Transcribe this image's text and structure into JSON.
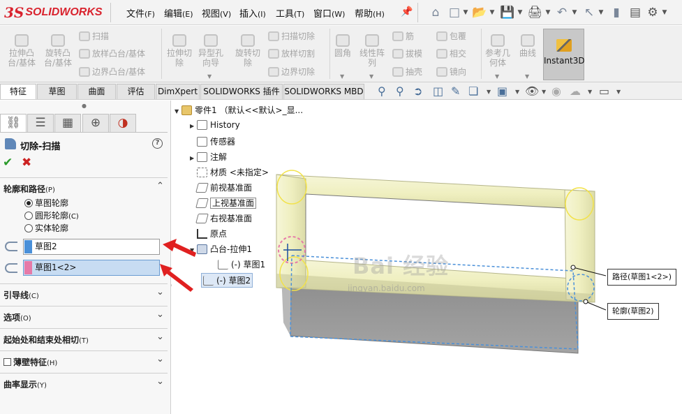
{
  "app": {
    "logo_prefix": "3S",
    "logo_text": "SOLIDWORKS"
  },
  "menu": [
    {
      "label": "文件",
      "accel": "(F)"
    },
    {
      "label": "编辑",
      "accel": "(E)"
    },
    {
      "label": "视图",
      "accel": "(V)"
    },
    {
      "label": "插入",
      "accel": "(I)"
    },
    {
      "label": "工具",
      "accel": "(T)"
    },
    {
      "label": "窗口",
      "accel": "(W)"
    },
    {
      "label": "帮助",
      "accel": "(H)"
    }
  ],
  "ribbon": {
    "extrude_boss": "拉伸凸台/基体",
    "revolve_boss": "旋转凸台/基体",
    "sweep": "扫描",
    "loft_boss": "放样凸台/基体",
    "boundary_boss": "边界凸台/基体",
    "extrude_cut": "拉伸切除",
    "hole_wizard": "异型孔向导",
    "revolve_cut": "旋转切除",
    "sweep_cut": "扫描切除",
    "loft_cut": "放样切割",
    "boundary_cut": "边界切除",
    "fillet": "圆角",
    "linear_pattern": "线性阵列",
    "rib": "筋",
    "draft": "拔模",
    "shell": "抽壳",
    "wrap": "包覆",
    "intersect": "相交",
    "mirror": "镜向",
    "ref_geometry": "参考几何体",
    "curves": "曲线",
    "instant3d": "Instant3D"
  },
  "tabs": [
    "特征",
    "草图",
    "曲面",
    "评估",
    "DimXpert",
    "SOLIDWORKS 插件",
    "SOLIDWORKS MBD"
  ],
  "panel": {
    "title": "切除-扫描",
    "help": "?",
    "profile_path": {
      "label": "轮廓和路径",
      "accel": "(P)"
    },
    "radios": [
      {
        "label": "草图轮廓",
        "accel": "",
        "checked": true
      },
      {
        "label": "圆形轮廓",
        "accel": "(C)",
        "checked": false
      },
      {
        "label": "实体轮廓",
        "accel": "",
        "checked": false
      }
    ],
    "profile_value": "草图2",
    "path_value": "草图1<2>",
    "sections": [
      {
        "label": "引导线",
        "accel": "(C)"
      },
      {
        "label": "选项",
        "accel": "(O)"
      },
      {
        "label": "起始处和结束处相切",
        "accel": "(T)"
      },
      {
        "label": "薄壁特征",
        "accel": "(H)"
      },
      {
        "label": "曲率显示",
        "accel": "(Y)"
      }
    ]
  },
  "tree": {
    "root": "零件1 （默认<<默认>_显...",
    "history": "History",
    "sensors": "传感器",
    "annotations": "注解",
    "material": "材质 <未指定>",
    "front_plane": "前视基准面",
    "top_plane": "上视基准面",
    "right_plane": "右视基准面",
    "origin": "原点",
    "boss_extrude": "凸台-拉伸1",
    "sketch1": "(-) 草图1",
    "sketch2": "(-) 草图2"
  },
  "callouts": {
    "path": "路径(草图1<2>)",
    "profile": "轮廓(草图2)"
  },
  "watermark": {
    "text": "Bai 经验",
    "url": "jingyan.baidu.com"
  },
  "colors": {
    "accent_red": "#d9232e",
    "profile_swatch": "#4a90d9",
    "path_swatch": "#e67aa8",
    "tube_yellow": "#efefc0"
  }
}
